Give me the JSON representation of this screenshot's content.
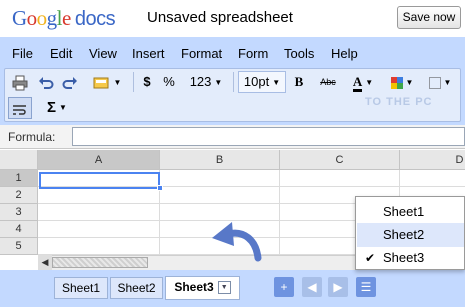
{
  "header": {
    "logo_google": [
      "G",
      "o",
      "o",
      "g",
      "l",
      "e"
    ],
    "logo_docs": "docs",
    "doc_title": "Unsaved spreadsheet",
    "save_button": "Save now"
  },
  "menu": [
    "File",
    "Edit",
    "View",
    "Insert",
    "Format",
    "Form",
    "Tools",
    "Help"
  ],
  "toolbar": {
    "currency": "$",
    "percent": "%",
    "number_format": "123",
    "font_size": "10pt",
    "bold": "B",
    "strike": "Abc",
    "text_color": "A",
    "sum": "Σ"
  },
  "formula": {
    "label": "Formula:",
    "value": ""
  },
  "grid": {
    "columns": [
      "A",
      "B",
      "C",
      "D"
    ],
    "rows": [
      "1",
      "2",
      "3",
      "4",
      "5"
    ],
    "selected_cell": "A1"
  },
  "sheets": {
    "tabs": [
      "Sheet1",
      "Sheet2",
      "Sheet3"
    ],
    "active": "Sheet3",
    "add": "+",
    "menu_items": [
      "Sheet1",
      "Sheet2",
      "Sheet3"
    ],
    "menu_checked": "Sheet3",
    "menu_highlighted": "Sheet2"
  },
  "watermark": "TO THE PC",
  "colors": {
    "chrome_blue": "#c3d9ff",
    "toolbar_bg": "#e3ecfb",
    "selection": "#4b83f1",
    "nav_button": "#6e93e0",
    "arrow": "#5878c8"
  }
}
